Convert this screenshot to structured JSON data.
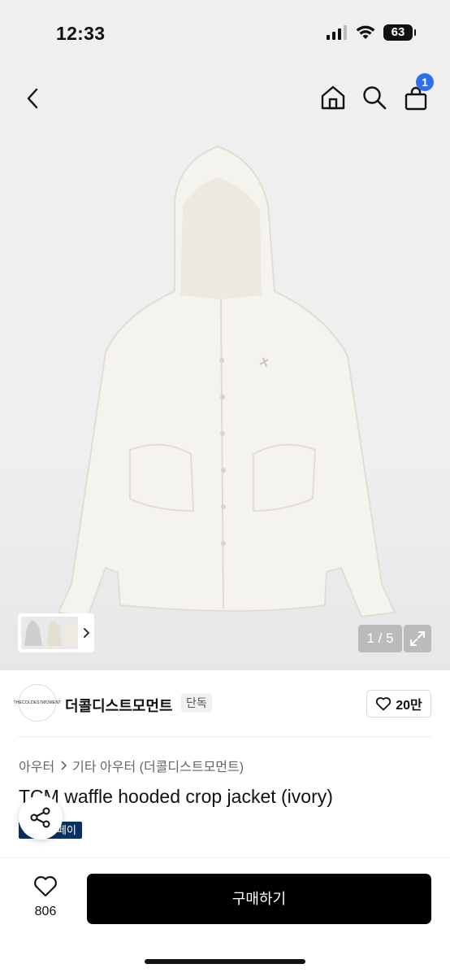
{
  "status_bar": {
    "time": "12:33",
    "battery": "63"
  },
  "nav": {
    "cart_count": "1"
  },
  "gallery": {
    "page_indicator": "1 / 5"
  },
  "seller": {
    "name": "더콜디스트모먼트",
    "avatar_text": "THECOLDESTMOMENT",
    "badge": "단독",
    "likes": "20만"
  },
  "breadcrumb": {
    "level1": "아우터",
    "level2": "기타 아우터 (더콜디스트모먼트)"
  },
  "product": {
    "title": "TCM waffle hooded crop jacket (ivory)",
    "tag": "페이"
  },
  "bottom": {
    "like_count": "806",
    "buy_label": "구매하기"
  },
  "icons": [
    "back-icon",
    "home-icon",
    "search-icon",
    "cart-icon",
    "chevron-right-icon",
    "expand-icon",
    "heart-icon",
    "share-icon"
  ],
  "colors": {
    "accent_blue": "#2f6fed",
    "tag_navy": "#0a3060",
    "buy_button": "#000000"
  }
}
